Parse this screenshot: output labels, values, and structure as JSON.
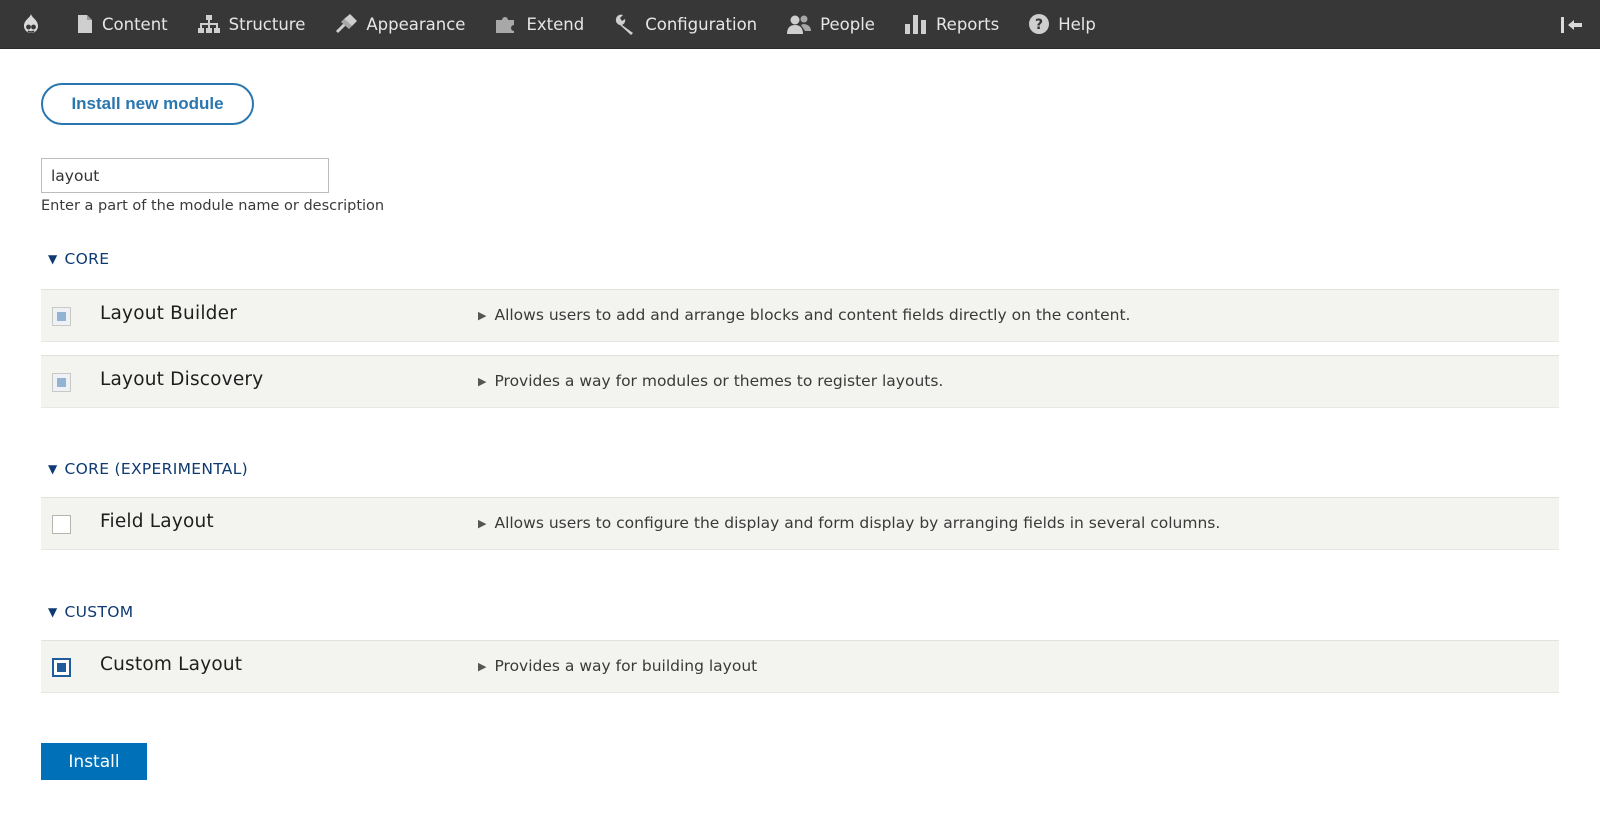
{
  "toolbar": {
    "items": [
      {
        "label": "Content",
        "icon": "document-icon"
      },
      {
        "label": "Structure",
        "icon": "sitemap-icon"
      },
      {
        "label": "Appearance",
        "icon": "brush-icon"
      },
      {
        "label": "Extend",
        "icon": "puzzle-icon"
      },
      {
        "label": "Configuration",
        "icon": "wrench-icon"
      },
      {
        "label": "People",
        "icon": "people-icon"
      },
      {
        "label": "Reports",
        "icon": "bar-chart-icon"
      },
      {
        "label": "Help",
        "icon": "help-icon"
      }
    ]
  },
  "page": {
    "install_new_label": "Install new module",
    "filter": {
      "value": "layout",
      "description": "Enter a part of the module name or description"
    },
    "sections": [
      {
        "title": "CORE",
        "modules": [
          {
            "name": "Layout Builder",
            "description": "Allows users to add and arrange blocks and content fields directly on the content.",
            "state": "disabled-checked"
          },
          {
            "name": "Layout Discovery",
            "description": "Provides a way for modules or themes to register layouts.",
            "state": "disabled-checked"
          }
        ]
      },
      {
        "title": "CORE (EXPERIMENTAL)",
        "modules": [
          {
            "name": "Field Layout",
            "description": "Allows users to configure the display and form display by arranging fields in several columns.",
            "state": "unchecked"
          }
        ]
      },
      {
        "title": "CUSTOM",
        "modules": [
          {
            "name": "Custom Layout",
            "description": "Provides a way for building layout",
            "state": "checked"
          }
        ]
      }
    ],
    "install_label": "Install"
  },
  "colors": {
    "toolbar_bg": "#373737",
    "link_blue": "#2a77b0",
    "primary_button": "#0071b8",
    "row_bg": "#f3f3ef",
    "section_heading": "#0e3a73"
  }
}
